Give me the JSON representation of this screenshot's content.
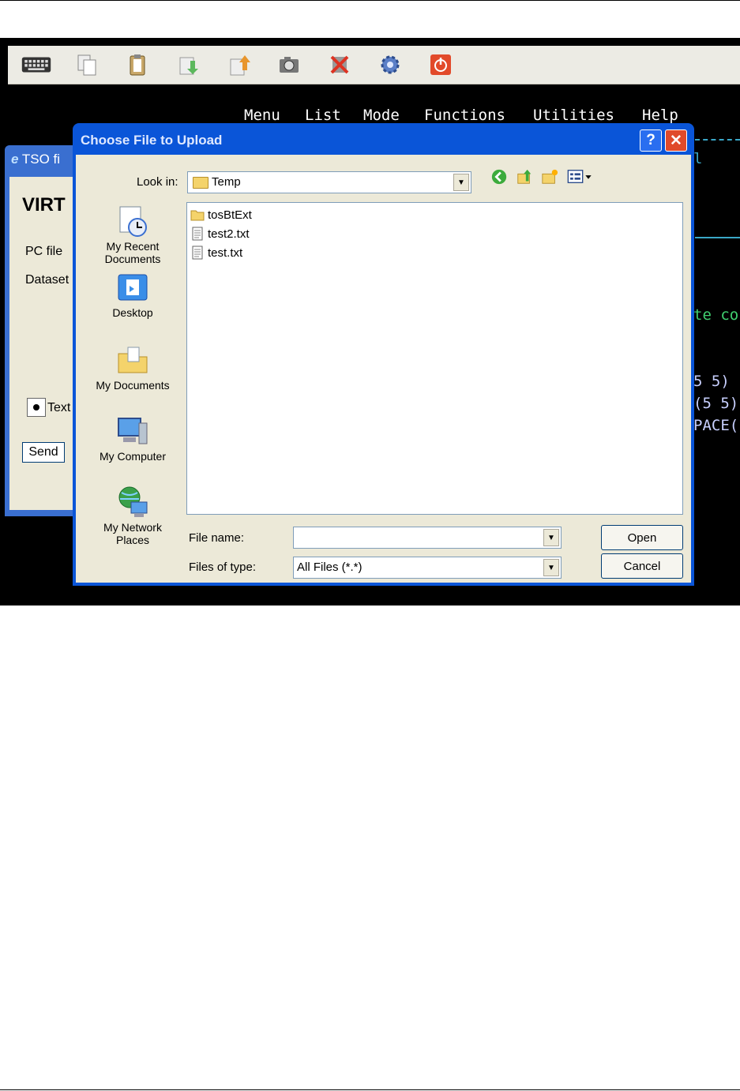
{
  "terminal": {
    "menubar": [
      "Menu",
      "List",
      "Mode",
      "Functions",
      "Utilities",
      "Help"
    ],
    "fragments": [
      "l",
      "te co",
      "5 5)",
      "(5 5)",
      "PACE("
    ]
  },
  "background_window": {
    "title": "TSO fi",
    "heading": "VIRT",
    "pc_file_label": "PC file",
    "dataset_label": "Dataset",
    "text_radio_label": "Text",
    "send_label": "Send"
  },
  "dialog": {
    "title": "Choose File to Upload",
    "help_glyph": "?",
    "close_glyph": "✕",
    "look_in_label": "Look in:",
    "look_in_value": "Temp",
    "places": [
      {
        "line1": "My Recent",
        "line2": "Documents",
        "icon": "recent-documents-icon"
      },
      {
        "line1": "Desktop",
        "line2": "",
        "icon": "desktop-icon"
      },
      {
        "line1": "My Documents",
        "line2": "",
        "icon": "my-documents-icon"
      },
      {
        "line1": "My Computer",
        "line2": "",
        "icon": "my-computer-icon"
      },
      {
        "line1": "My Network",
        "line2": "Places",
        "icon": "network-places-icon"
      }
    ],
    "files": [
      {
        "name": "tosBtExt",
        "kind": "folder"
      },
      {
        "name": "test2.txt",
        "kind": "text"
      },
      {
        "name": "test.txt",
        "kind": "text"
      }
    ],
    "file_name_label": "File name:",
    "file_name_value": "",
    "files_of_type_label": "Files of type:",
    "files_of_type_value": "All Files (*.*)",
    "open_label": "Open",
    "cancel_label": "Cancel"
  },
  "colors": {
    "title_bar": "#0a55d8",
    "dialog_face": "#ece9d8",
    "terminal_bg": "#000000",
    "terminal_green": "#40d070"
  }
}
